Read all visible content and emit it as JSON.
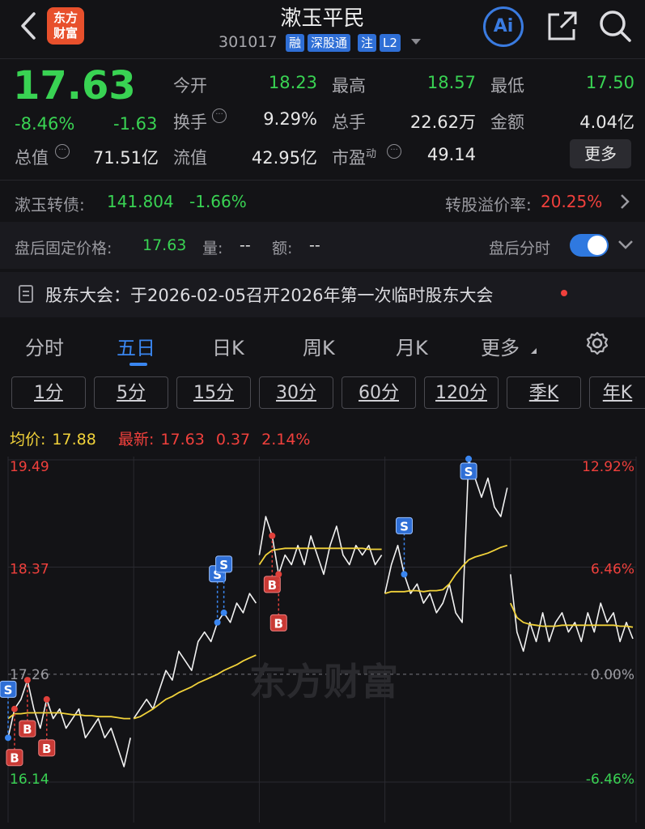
{
  "header": {
    "logo_line1": "东方",
    "logo_line2": "财富",
    "title": "漱玉平民",
    "code": "301017",
    "tags": [
      "融",
      "深股通",
      "注",
      "L2"
    ],
    "ai_label": "Ai"
  },
  "quote": {
    "price": "17.63",
    "change_pct": "-8.46%",
    "change": "-1.63",
    "fields": {
      "open_label": "今开",
      "open": "18.23",
      "high_label": "最高",
      "high": "18.57",
      "low_label": "最低",
      "low": "17.50",
      "turnover_label": "换手",
      "turnover": "9.29%",
      "volume_label": "总手",
      "volume": "22.62万",
      "amount_label": "金额",
      "amount": "4.04亿",
      "mktcap_label": "总值",
      "mktcap": "71.51亿",
      "float_label": "流值",
      "float": "42.95亿",
      "pe_label": "市盈",
      "pe_sup": "动",
      "pe": "49.14"
    },
    "more_button": "更多"
  },
  "bond": {
    "label": "漱玉转债:",
    "price": "141.804",
    "change": "-1.66%",
    "premium_label": "转股溢价率:",
    "premium": "20.25%"
  },
  "after_hours": {
    "label": "盘后固定价格:",
    "price": "17.63",
    "vol_label": "量:",
    "vol": "--",
    "amt_label": "额:",
    "amt": "--",
    "toggle_label": "盘后分时",
    "toggle_on": true
  },
  "notice": {
    "text": "股东大会：于2026-02-05召开2026年第一次临时股东大会"
  },
  "tabs": [
    "分时",
    "五日",
    "日K",
    "周K",
    "月K",
    "更多"
  ],
  "active_tab": "五日",
  "intervals": [
    "1分",
    "5分",
    "15分",
    "30分",
    "60分",
    "120分",
    "季K",
    "年K"
  ],
  "chart_header": {
    "avg_label": "均价:",
    "avg": "17.88",
    "latest_label": "最新:",
    "latest": "17.63",
    "latest_change": "0.37",
    "latest_pct": "2.14%"
  },
  "watermark": "东方财富",
  "chart_data": {
    "type": "line",
    "days": 5,
    "y_labels_left": [
      "19.49",
      "18.37",
      "17.26",
      "16.14"
    ],
    "y_labels_right": [
      "12.92%",
      "6.46%",
      "0.00%",
      "-6.46%"
    ],
    "ylim": [
      16.14,
      19.49
    ],
    "base": 17.26,
    "series": [
      {
        "values": [
          16.6,
          16.9,
          17.0,
          17.2,
          16.9,
          16.7,
          17.0,
          16.8,
          16.9,
          16.7,
          16.8,
          16.9,
          16.6,
          16.7,
          16.8,
          16.6,
          16.7,
          16.5,
          16.3,
          16.6,
          16.8,
          16.9,
          17.0,
          16.9,
          17.1,
          17.3,
          17.2,
          17.5,
          17.4,
          17.3,
          17.6,
          17.7,
          17.6,
          17.8,
          17.9,
          17.8,
          18.0,
          17.9,
          18.1,
          18.0,
          18.5,
          18.9,
          18.7,
          18.3,
          18.5,
          18.4,
          18.6,
          18.4,
          18.7,
          18.5,
          18.3,
          18.6,
          18.8,
          18.5,
          18.4,
          18.6,
          18.5,
          18.6,
          18.4,
          18.5,
          18.1,
          18.4,
          18.6,
          18.3,
          18.1,
          18.2,
          18.0,
          18.1,
          17.9,
          18.0,
          18.2,
          17.9,
          17.8,
          19.5,
          19.3,
          19.1,
          19.3,
          19.0,
          18.9,
          19.2,
          18.3,
          17.7,
          17.5,
          17.8,
          17.6,
          17.9,
          17.6,
          17.8,
          17.9,
          17.7,
          17.8,
          17.6,
          17.9,
          17.7,
          18.0,
          17.8,
          17.9,
          17.6,
          17.8,
          17.63
        ]
      },
      {
        "values": [
          16.8,
          16.85,
          16.85,
          16.86,
          16.86,
          16.86,
          16.86,
          16.86,
          16.86,
          16.85,
          16.84,
          16.84,
          16.83,
          16.83,
          16.82,
          16.82,
          16.82,
          16.81,
          16.8,
          16.8,
          16.8,
          16.82,
          16.86,
          16.9,
          16.95,
          17.0,
          17.03,
          17.07,
          17.1,
          17.13,
          17.17,
          17.2,
          17.23,
          17.26,
          17.3,
          17.33,
          17.36,
          17.4,
          17.43,
          17.46,
          18.4,
          18.5,
          18.55,
          18.56,
          18.57,
          18.57,
          18.57,
          18.57,
          18.57,
          18.57,
          18.57,
          18.57,
          18.57,
          18.57,
          18.57,
          18.57,
          18.57,
          18.56,
          18.56,
          18.56,
          18.1,
          18.12,
          18.12,
          18.12,
          18.13,
          18.13,
          18.12,
          18.13,
          18.13,
          18.14,
          18.2,
          18.3,
          18.38,
          18.45,
          18.48,
          18.5,
          18.52,
          18.55,
          18.58,
          18.6,
          18.0,
          17.85,
          17.8,
          17.78,
          17.77,
          17.76,
          17.76,
          17.76,
          17.77,
          17.77,
          17.77,
          17.77,
          17.77,
          17.77,
          17.77,
          17.77,
          17.77,
          17.76,
          17.76,
          17.75
        ]
      }
    ],
    "markers_buy": [
      "B",
      "B",
      "B",
      "B",
      "B"
    ],
    "markers_sell": [
      "S",
      "S",
      "S",
      "S",
      "S"
    ]
  }
}
